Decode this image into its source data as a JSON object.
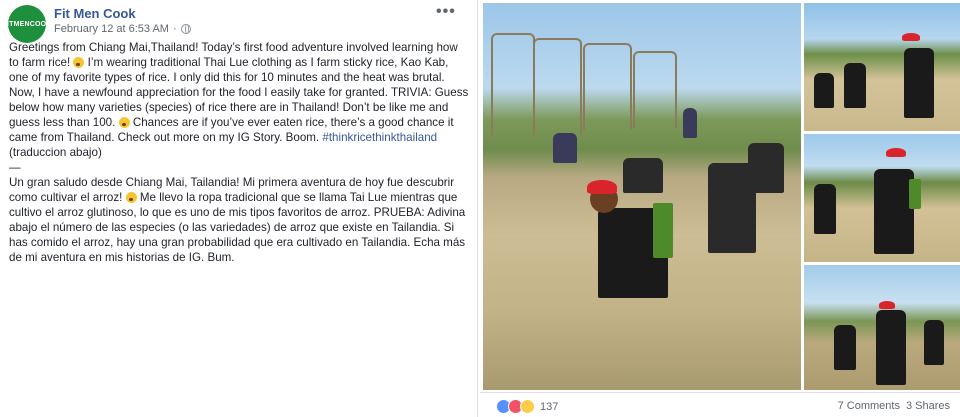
{
  "post": {
    "page_name": "Fit Men Cook",
    "avatar_text": "FITMENCOOK",
    "timestamp": "February 12 at 6:53 AM",
    "more_label": "•••",
    "body_en_1": "Greetings from Chiang Mai,Thailand! Today’s first food adventure involved learning how to farm rice!",
    "body_en_2": "I’m wearing traditional Thai Lue clothing as I farm sticky rice, Kao Kab, one of my favorite types of rice. I only did this for 10 minutes and the heat was brutal. Now, I have a newfound appreciation for the food I easily take for granted. TRIVIA: Guess below how many varieties (species) of rice there are in Thailand! Don’t be like me and guess less than 100.",
    "body_en_3": "Chances are if you’ve ever eaten rice, there’s a good chance it came from Thailand. Check out more on my IG Story. Boom.",
    "hashtag": "#thinkricethinkthailand",
    "translation_note": "(traduccion abajo)",
    "divider": "—",
    "body_es_1": "Un gran saludo desde Chiang Mai, Tailandia! Mi primera aventura de hoy fue descubrir como cultivar el arroz!",
    "body_es_2": "Me llevo la ropa tradicional que se llama Tai Lue mientras que cultivo el arroz glutinoso, lo que es uno de mis tipos favoritos de arroz. PRUEBA: Adivina abajo el número de las especies (o las variedades) de arroz que existe en Tailandia. Si has comido el arroz, hay una gran probabilidad que era cultivado en Tailandia. Echa más de mi aventura en mis historias de IG. Bum."
  },
  "footer": {
    "reaction_count": "137",
    "comments": "7 Comments",
    "shares": "3 Shares"
  },
  "icons": {
    "reactions": [
      "like-icon",
      "love-icon",
      "wow-icon"
    ],
    "privacy": "globe-icon"
  }
}
